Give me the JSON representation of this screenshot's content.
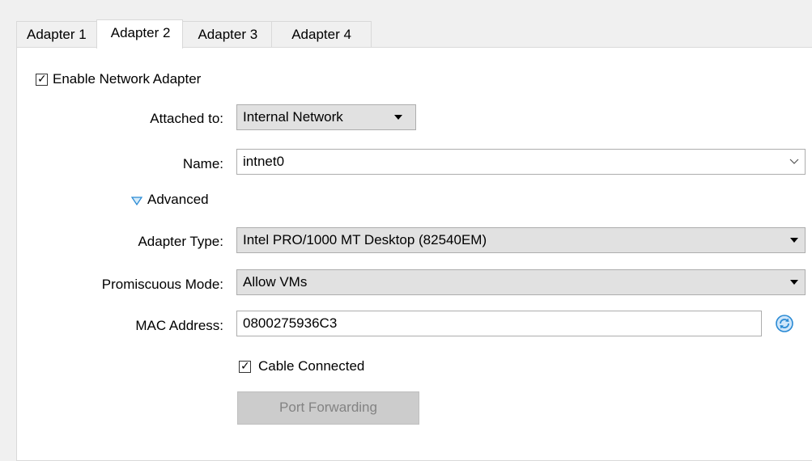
{
  "tabs": [
    {
      "label": "Adapter 1"
    },
    {
      "label": "Adapter 2"
    },
    {
      "label": "Adapter 3"
    },
    {
      "label": "Adapter 4"
    }
  ],
  "active_tab": "Adapter 2",
  "enable_adapter": {
    "label": "Enable Network Adapter",
    "checked": true
  },
  "attached_to": {
    "label": "Attached to:",
    "value": "Internal Network"
  },
  "name": {
    "label": "Name:",
    "value": "intnet0"
  },
  "advanced": {
    "label": "Advanced",
    "expanded": true
  },
  "adapter_type": {
    "label": "Adapter Type:",
    "value": "Intel PRO/1000 MT Desktop (82540EM)"
  },
  "promiscuous_mode": {
    "label": "Promiscuous Mode:",
    "value": "Allow VMs"
  },
  "mac_address": {
    "label": "MAC Address:",
    "value": "0800275936C3"
  },
  "cable_connected": {
    "label": "Cable Connected",
    "checked": true
  },
  "port_forwarding": {
    "label": "Port Forwarding",
    "enabled": false
  },
  "icons": {
    "checkbox": "check-icon",
    "advanced": "triangle-down-icon",
    "refresh": "refresh-icon"
  },
  "colors": {
    "accent_blue": "#2a8ad4",
    "combo_gray": "#e1e1e1",
    "disabled_button": "#cccccc"
  }
}
